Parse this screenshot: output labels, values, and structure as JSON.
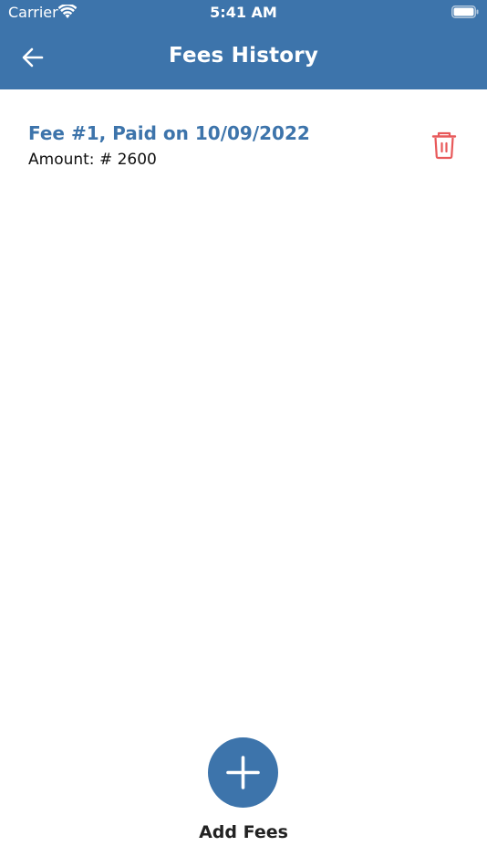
{
  "status_bar": {
    "carrier": "Carrier",
    "time": "5:41 AM",
    "wifi_icon": "wifi-icon",
    "battery_icon": "battery-icon"
  },
  "nav": {
    "title": "Fees History",
    "back_icon": "arrow-left-icon"
  },
  "fees": [
    {
      "title": "Fee #1, Paid on 10/09/2022",
      "amount_label": "Amount:",
      "amount_value": "# 2600",
      "delete_icon": "trash-icon"
    }
  ],
  "add_fees": {
    "label": "Add Fees",
    "icon": "plus-icon"
  },
  "colors": {
    "primary": "#3d74ab",
    "delete": "#e8595a",
    "background": "#ffffff"
  }
}
